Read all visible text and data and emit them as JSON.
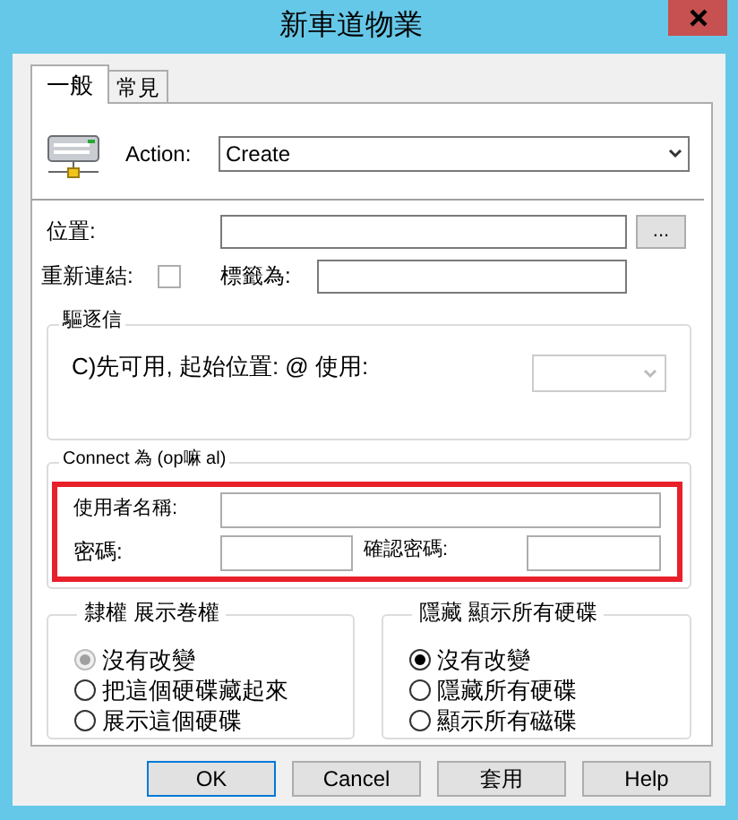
{
  "window": {
    "title": "新車道物業"
  },
  "tabs": [
    {
      "label": "一般",
      "selected": true
    },
    {
      "label": "常見",
      "selected": false
    }
  ],
  "action": {
    "label": "Action:",
    "value": "Create"
  },
  "location": {
    "label": "位置:",
    "browse_button": "..."
  },
  "reconnect": {
    "label": "重新連結:",
    "checked": false
  },
  "label_as": {
    "label": "標籤為:"
  },
  "drive_letter_group": {
    "title": "驅逐信",
    "option": "C)先可用, 起始位置: @ 使用:"
  },
  "connect_as_group": {
    "title": "Connect 為 (op嘛 al)",
    "username_label": "使用者名稱:",
    "password_label": "密碼:",
    "confirm_label": "確認密碼:"
  },
  "hide_show_this_group": {
    "title": "隸權 展示巻權",
    "options": [
      {
        "label": "沒有改變",
        "selected": true,
        "disabled": true
      },
      {
        "label": "把這個硬碟藏起來",
        "selected": false,
        "disabled": false
      },
      {
        "label": "展示這個硬碟",
        "selected": false,
        "disabled": false
      }
    ]
  },
  "hide_show_all_group": {
    "title": "隱藏 顯示所有硬碟",
    "options": [
      {
        "label": "沒有改變",
        "selected": true,
        "disabled": false
      },
      {
        "label": "隱藏所有硬碟",
        "selected": false,
        "disabled": false
      },
      {
        "label": "顯示所有磁碟",
        "selected": false,
        "disabled": false
      }
    ]
  },
  "buttons": [
    {
      "label": "OK",
      "default": true
    },
    {
      "label": "Cancel",
      "default": false
    },
    {
      "label": "套用",
      "default": false
    },
    {
      "label": "Help",
      "default": false
    }
  ]
}
